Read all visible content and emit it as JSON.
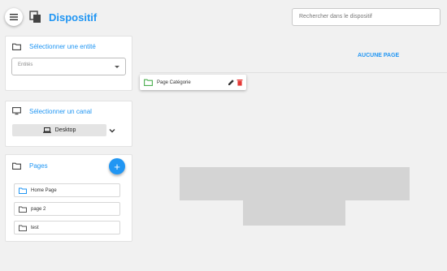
{
  "app": {
    "title": "Dispositif",
    "menu_icon": "menu-icon",
    "app_icon": "copy-stack-icon"
  },
  "search": {
    "placeholder": "Rechercher dans le dispositif"
  },
  "entity_card": {
    "title": "Sélectionner une entité",
    "select_placeholder": "Entités",
    "icon": "folder-icon"
  },
  "channel_card": {
    "title": "Sélectionner un canal",
    "selected": "Desktop",
    "icon": "monitor-icon"
  },
  "pages_card": {
    "title": "Pages",
    "add_label": "+",
    "items": [
      {
        "label": "Home Page"
      },
      {
        "label": "page 2"
      },
      {
        "label": "test"
      }
    ]
  },
  "main": {
    "empty_label": "AUCUNE PAGE",
    "category": {
      "label": "Page Catégorie"
    }
  },
  "colors": {
    "accent": "#2196f3",
    "delete": "#e53935",
    "folder_green": "#4caf50"
  }
}
